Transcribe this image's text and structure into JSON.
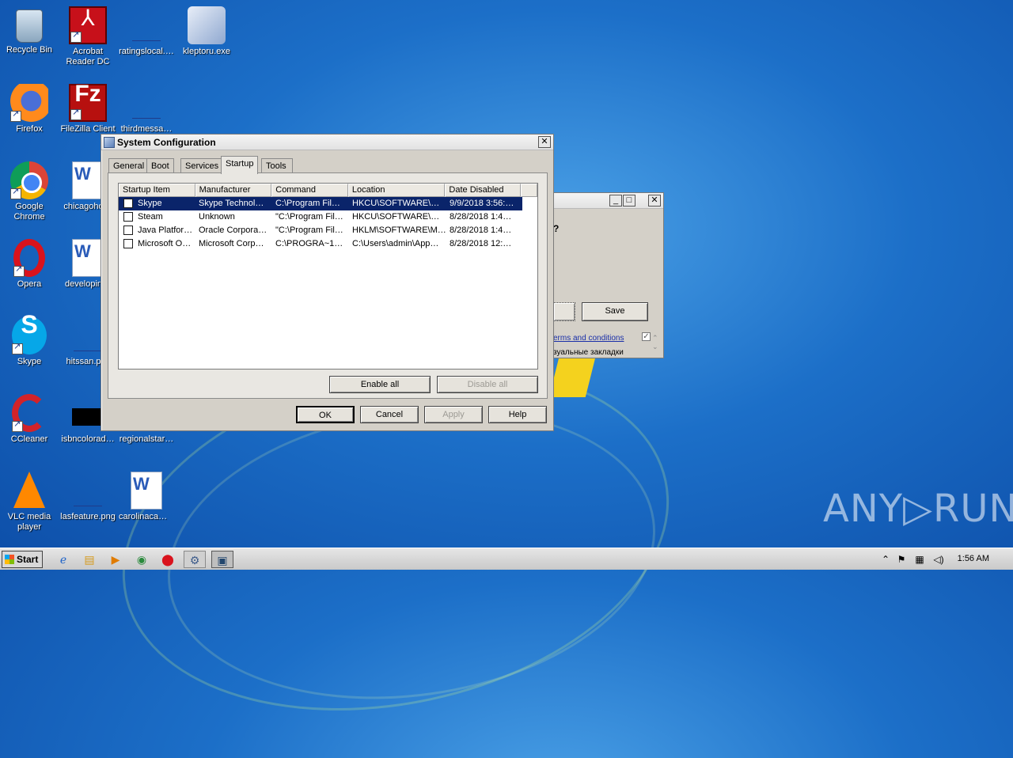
{
  "desktop": {
    "icons": [
      {
        "label": "Recycle Bin",
        "icon": "recycle-bin-icon"
      },
      {
        "label": "Acrobat Reader DC",
        "icon": "acrobat-icon"
      },
      {
        "label": "ratingslocal.…",
        "icon": "blank-file-icon"
      },
      {
        "label": "kleptoru.exe",
        "icon": "installer-icon"
      },
      {
        "label": "Firefox",
        "icon": "firefox-icon"
      },
      {
        "label": "FileZilla Client",
        "icon": "filezilla-icon"
      },
      {
        "label": "thirdmessa…",
        "icon": "blank-file-icon"
      },
      {
        "label": "Google Chrome",
        "icon": "chrome-icon"
      },
      {
        "label": "chicagoho…",
        "icon": "word-doc-icon"
      },
      {
        "label": "Opera",
        "icon": "opera-icon"
      },
      {
        "label": "developin…",
        "icon": "word-doc-icon"
      },
      {
        "label": "Skype",
        "icon": "skype-icon"
      },
      {
        "label": "hitssan.p…",
        "icon": "blank-file-icon"
      },
      {
        "label": "CCleaner",
        "icon": "ccleaner-icon"
      },
      {
        "label": "isbncolorad…",
        "icon": "black-image-icon"
      },
      {
        "label": "regionalstar…",
        "icon": "blank-file-icon"
      },
      {
        "label": "VLC media player",
        "icon": "vlc-icon"
      },
      {
        "label": "lasfeature.png",
        "icon": "blank-file-icon"
      },
      {
        "label": "carolinacam…",
        "icon": "word-doc-icon"
      }
    ],
    "watermark": "ANY▷RUN"
  },
  "bg_window": {
    "question_mark": "?",
    "save_label": "Save",
    "terms_link": "erms and conditions",
    "bookmarks_text": "зуальные закладки"
  },
  "msconfig": {
    "title": "System Configuration",
    "tabs": [
      "General",
      "Boot",
      "Services",
      "Startup",
      "Tools"
    ],
    "active_tab": "Startup",
    "columns": [
      "Startup Item",
      "Manufacturer",
      "Command",
      "Location",
      "Date Disabled"
    ],
    "rows": [
      {
        "item": "Skype",
        "manufacturer": "Skype Technol…",
        "command": "C:\\Program Fil…",
        "location": "HKCU\\SOFTWARE\\M…",
        "date": "9/9/2018 3:56:…"
      },
      {
        "item": "Steam",
        "manufacturer": "Unknown",
        "command": "\"C:\\Program Fil…",
        "location": "HKCU\\SOFTWARE\\M…",
        "date": "8/28/2018 1:4…"
      },
      {
        "item": "Java Platfor…",
        "manufacturer": "Oracle Corpora…",
        "command": "\"C:\\Program Fil…",
        "location": "HKLM\\SOFTWARE\\M…",
        "date": "8/28/2018 1:4…"
      },
      {
        "item": "Microsoft O…",
        "manufacturer": "Microsoft Corp…",
        "command": "C:\\PROGRA~1…",
        "location": "C:\\Users\\admin\\App…",
        "date": "8/28/2018 12:…"
      }
    ],
    "enable_all": "Enable all",
    "disable_all": "Disable all",
    "ok": "OK",
    "cancel": "Cancel",
    "apply": "Apply",
    "help": "Help",
    "close_glyph": "✕"
  },
  "taskbar": {
    "start_label": "Start",
    "clock": "1:56 AM"
  },
  "colors": {
    "selection": "#0a246a",
    "dialog_bg": "#d4d0c8"
  }
}
